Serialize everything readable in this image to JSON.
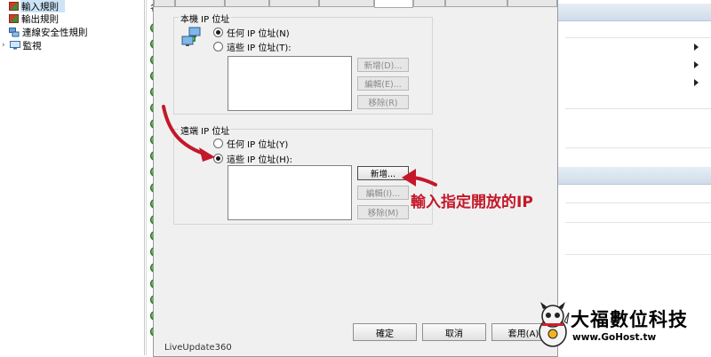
{
  "tree": {
    "items": [
      {
        "label": "輸入規則"
      },
      {
        "label": "輸出規則"
      },
      {
        "label": "連線安全性規則"
      },
      {
        "label": "監視"
      }
    ]
  },
  "list": {
    "partial_header": "名",
    "partial_bottom_text": "LiveUpdate360"
  },
  "dialog": {
    "local_group": {
      "title": "本機 IP 位址",
      "radio_any": "任何 IP 位址(N)",
      "radio_these": "這些 IP 位址(T):",
      "btn_add": "新增(D)...",
      "btn_edit": "編輯(E)...",
      "btn_remove": "移除(R)"
    },
    "remote_group": {
      "title": "遠端 IP 位址",
      "radio_any": "任何 IP 位址(Y)",
      "radio_these": "這些 IP 位址(H):",
      "btn_add": "新增...",
      "btn_edit": "編輯(I)...",
      "btn_remove": "移除(M)"
    },
    "footer": {
      "ok": "確定",
      "cancel": "取消",
      "apply": "套用(A)"
    }
  },
  "annotation": {
    "text": "輸入指定開放的IP",
    "color": "#c4182a"
  },
  "brand": {
    "name": "大福數位科技",
    "url": "www.GoHost.tw"
  }
}
